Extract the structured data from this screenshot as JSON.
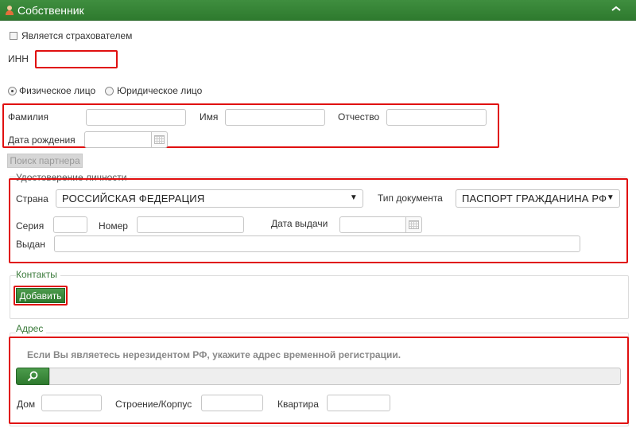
{
  "header": {
    "title": "Собственник"
  },
  "insurer": {
    "label": "Является страхователем",
    "checked": false
  },
  "inn": {
    "label": "ИНН",
    "value": ""
  },
  "person_type": {
    "options": [
      {
        "label": "Физическое лицо",
        "selected": true
      },
      {
        "label": "Юридическое лицо",
        "selected": false
      }
    ]
  },
  "person": {
    "last_name_label": "Фамилия",
    "first_name_label": "Имя",
    "middle_name_label": "Отчество",
    "birth_date_label": "Дата рождения"
  },
  "search_partner": {
    "label": "Поиск партнера"
  },
  "identity": {
    "title": "Удостоверение личности",
    "country_label": "Страна",
    "country_value": "РОССИЙСКАЯ ФЕДЕРАЦИЯ",
    "doc_type_label": "Тип документа",
    "doc_type_value": "ПАСПОРТ ГРАЖДАНИНА РФ",
    "series_label": "Серия",
    "number_label": "Номер",
    "issue_date_label": "Дата выдачи",
    "issued_by_label": "Выдан"
  },
  "contacts": {
    "title": "Контакты",
    "add_label": "Добавить"
  },
  "address": {
    "title": "Адрес",
    "hint": "Если Вы являетесь нерезидентом РФ, укажите адрес временной регистрации.",
    "house_label": "Дом",
    "building_label": "Строение/Корпус",
    "apartment_label": "Квартира"
  },
  "colors": {
    "header_green": "#2e7a2e",
    "highlight_red": "#e01010",
    "section_title": "#3a7a3a"
  },
  "icons": {
    "header": "person-icon",
    "collapse": "chevron-up-icon",
    "search": "search-icon",
    "calendar": "calendar-icon"
  }
}
